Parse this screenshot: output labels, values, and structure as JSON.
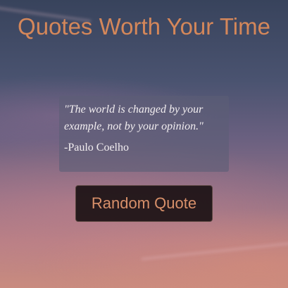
{
  "header": {
    "title": "Quotes Worth Your Time"
  },
  "quote": {
    "text": "\"The world is changed by your example, not by your opinion.\"",
    "author": "-Paulo Coelho"
  },
  "actions": {
    "random_label": "Random Quote"
  },
  "colors": {
    "accent": "#d4875a",
    "quote_text": "#f2eef0",
    "button_bg": "#181012"
  }
}
